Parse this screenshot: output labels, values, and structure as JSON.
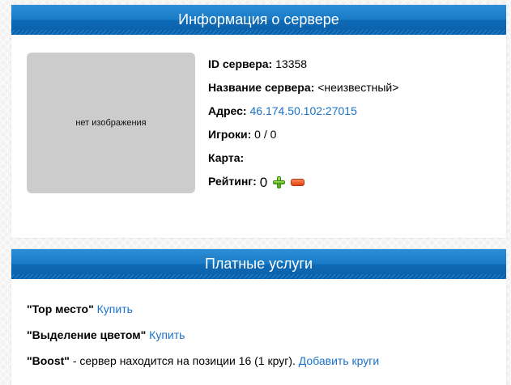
{
  "server_panel": {
    "title": "Информация о сервере",
    "no_image_text": "нет изображения",
    "fields": {
      "id_label": "ID сервера:",
      "id_value": "13358",
      "name_label": "Название сервера:",
      "name_value": "<неизвестный>",
      "address_label": "Адрес:",
      "address_value": "46.174.50.102:27015",
      "players_label": "Игроки:",
      "players_value": "0 / 0",
      "map_label": "Карта:",
      "map_value": "",
      "rating_label": "Рейтинг:",
      "rating_value": "0"
    },
    "icons": {
      "rate_up": "plus-icon",
      "rate_down": "minus-icon"
    }
  },
  "paid_panel": {
    "title": "Платные услуги",
    "services": [
      {
        "name": "\"Top место\"",
        "text": "",
        "action": "Купить"
      },
      {
        "name": "\"Выделение цветом\"",
        "text": "",
        "action": "Купить"
      },
      {
        "name": "\"Boost\"",
        "text": " - сервер находится на позиции 16 (1 круг). ",
        "action": "Добавить круги"
      }
    ]
  },
  "colors": {
    "header_blue": "#0f6ab6",
    "link_blue": "#1a73c8",
    "placeholder_gray": "#cccccc",
    "plus_green": "#4fa81c",
    "minus_orange": "#e0420f"
  }
}
